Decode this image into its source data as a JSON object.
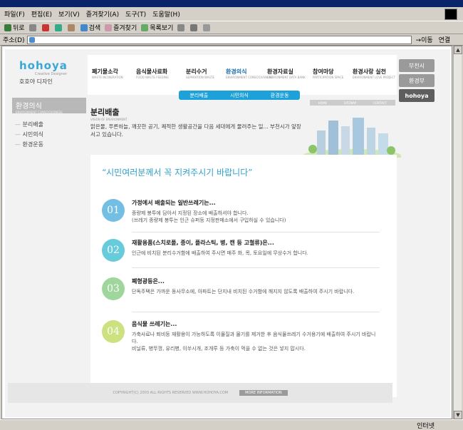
{
  "browser": {
    "menu": [
      "파일(F)",
      "편집(E)",
      "보기(V)",
      "즐겨찾기(A)",
      "도구(T)",
      "도움말(H)"
    ],
    "toolbar": {
      "back": "뒤로",
      "search": "검색",
      "favorites": "즐겨찾기",
      "history": "목록보기"
    },
    "address_label": "주소(D)",
    "go_label": "이동",
    "links_label": "연결",
    "status_zone": "인터넷"
  },
  "site": {
    "logo": {
      "mark": "hohoya",
      "tagline": "Creative Designer",
      "name_kr": "호호야 디자인"
    },
    "nav": [
      {
        "kr": "폐기물소각",
        "en": "WASTE INCINERATION"
      },
      {
        "kr": "음식물사료화",
        "en": "FOOD WASTE FEEDING"
      },
      {
        "kr": "분리수거",
        "en": "SEPARATION WASTE"
      },
      {
        "kr": "환경의식",
        "en": "ENVIRONMENT CONSCIOUSNESS"
      },
      {
        "kr": "환경자료실",
        "en": "ENVIRONMENT DATA BANK"
      },
      {
        "kr": "참여마당",
        "en": "PARTICIPATION SPACE"
      },
      {
        "kr": "환경사랑 실천",
        "en": "ENVIRONMENT LOVE PROJECT"
      }
    ],
    "subnav": [
      "분리배출",
      "시민의식",
      "환경운동"
    ],
    "right_buttons": [
      "부천시",
      "환경부",
      "hohoya"
    ],
    "util": [
      "HOME",
      "SITEMAP",
      "CONTACT"
    ],
    "sidebar": {
      "title": "환경의식",
      "title_en": "ENVIRONMENT CONSCIOUSNESS",
      "items": [
        "분리배출",
        "시민의식",
        "환경운동"
      ]
    },
    "page": {
      "title": "분리배출",
      "title_en": "VISION OF ENVIRONMENT",
      "intro": "맑은물, 푸른하늘, 깨끗한 공기, 쾌적한 생활공간을 다음 세대에게 물려주는 일... 부천시가 앞장서고 있습니다.",
      "slogan": "“시민여러분께서 꼭 지켜주시기 바랍니다”"
    },
    "steps": [
      {
        "num": "01",
        "color": "#5bb4e0",
        "title": "가정에서 배출되는 일반쓰레기는...",
        "desc": [
          "종량제 봉투에 담아서 지정된 장소에 배출하셔야 합니다.",
          "(쓰레기 종량제 봉투는 인근 슈퍼등 지정판매소에서 구입하실 수 있습니다)"
        ]
      },
      {
        "num": "02",
        "color": "#4cc4d6",
        "title": "재활용품(스치로폴, 종이, 플라스틱, 병, 캔 등 고철류)은...",
        "desc": [
          "인근에 비치된 분리수거함에 배출하여 주시면 매주 화, 목, 토요일에 무상수거 합니다."
        ]
      },
      {
        "num": "03",
        "color": "#8fd08a",
        "title": "폐형광등은...",
        "desc": [
          "단독주택은 가까운 동사무소에, 아파트는 단지내 비치된 수거함에 깨지지 않도록 배출하여 주시기 바랍니다."
        ]
      },
      {
        "num": "04",
        "color": "#c4dc6a",
        "title": "음식물 쓰레기는...",
        "desc": [
          "가축사료나 퇴비등 재활용이 가능하도록 이물질과 물기를 제거한 후 음식물쓰레기 수거용기에 배출하여 주시기 바랍니다.",
          "비닐류, 병뚜껑, 유리병, 이쑤시개, 조개루 등 가축이 먹을 수 없는 것은 넣지 맙시다."
        ]
      }
    ],
    "footer": {
      "copyright": "COPYRIGHT(C) 2003 ALL RIGHTS RESERVED WWW.HOHOYA.COM",
      "more": "MORE INFORMATION"
    }
  }
}
